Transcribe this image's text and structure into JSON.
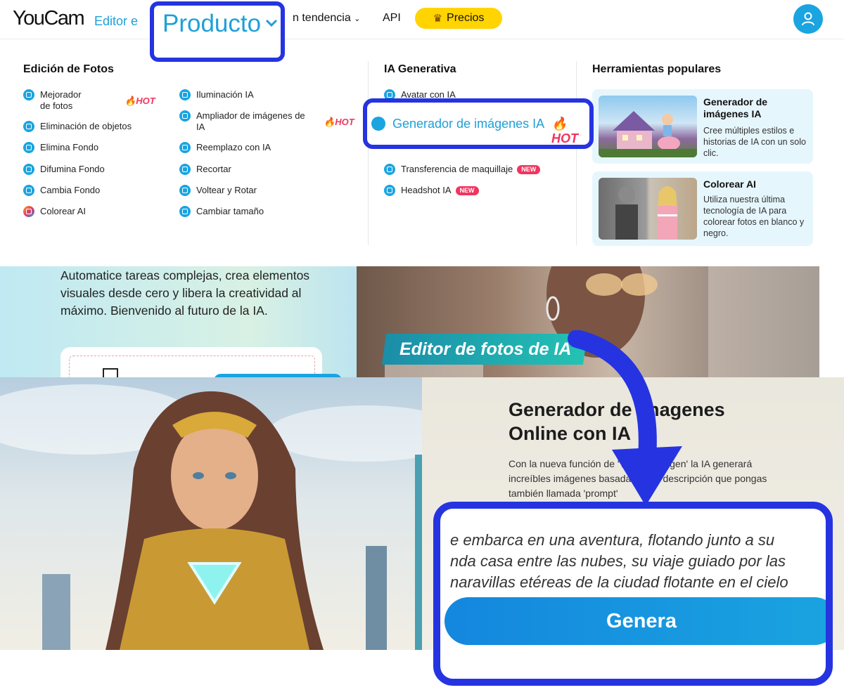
{
  "nav": {
    "logo": "YouCam",
    "logo_sub": "Editor e",
    "producto": "Producto",
    "trend": "n tendencia",
    "api": "API",
    "precios": "Precios"
  },
  "menu": {
    "col1_title": "Edición de Fotos",
    "col1_left": [
      {
        "label": "Mejorador de fotos",
        "hot": "HOT"
      },
      {
        "label": "Eliminación de objetos"
      },
      {
        "label": "Elimina Fondo"
      },
      {
        "label": "Difumina Fondo"
      },
      {
        "label": "Cambia Fondo"
      },
      {
        "label": "Colorear AI"
      }
    ],
    "col1_right": [
      {
        "label": "Iluminación IA"
      },
      {
        "label": "Ampliador de imágenes de IA",
        "hot": "HOT"
      },
      {
        "label": "Reemplazo con IA"
      },
      {
        "label": "Recortar"
      },
      {
        "label": "Voltear y Rotar"
      },
      {
        "label": "Cambiar tamaño"
      }
    ],
    "col2_title": "IA Generativa",
    "col2": [
      {
        "label": "Avatar con IA"
      },
      {
        "label": "Generador de imágenes IA",
        "hot": "HOT"
      },
      {
        "label": "Transferencia de maquillaje",
        "badge": "NEW"
      },
      {
        "label": "Headshot IA",
        "badge": "NEW"
      }
    ],
    "col3_title": "Herramientas populares",
    "cards": [
      {
        "title": "Generador de imágenes IA",
        "desc": "Cree múltiples estilos e historias de IA con un solo clic."
      },
      {
        "title": "Colorear AI",
        "desc": "Utiliza nuestra última tecnología de IA para colorear fotos en blanco y negro."
      }
    ]
  },
  "page": {
    "hero_text": "Automatice tareas complejas, crea elementos visuales desde cero y libera la creatividad al máximo. Bienvenido al futuro de la IA.",
    "banner": "Editor de fotos de IA"
  },
  "bottom": {
    "title": "Generador de imagenes Online con IA",
    "desc": "Con la nueva función de 'Texto a imagen' la IA generará increíbles imágenes basadas en la descripción que pongas también llamada 'prompt'",
    "prompt_lines": [
      "e embarca en una aventura, flotando junto a su",
      "nda casa entre las nubes, su viaje guiado por las",
      "naravillas etéreas de la ciudad flotante en el cielo"
    ],
    "button": "Genera"
  },
  "colors": {
    "highlight": "#2534e0",
    "accent": "#1aa4e0",
    "hot": "#f0355f",
    "precios": "#ffd400"
  }
}
